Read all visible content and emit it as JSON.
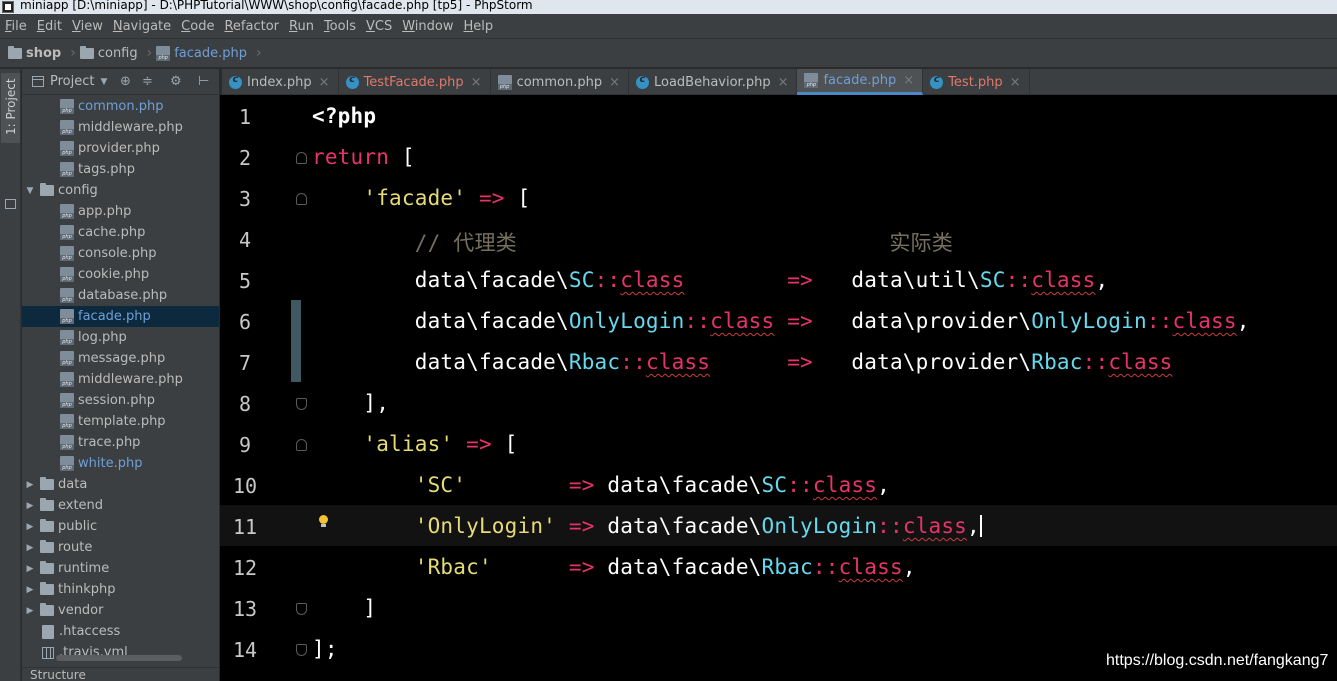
{
  "window": {
    "title": "miniapp [D:\\miniapp] - D:\\PHPTutorial\\WWW\\shop\\config\\facade.php [tp5] - PhpStorm"
  },
  "menu": [
    "File",
    "Edit",
    "View",
    "Navigate",
    "Code",
    "Refactor",
    "Run",
    "Tools",
    "VCS",
    "Window",
    "Help"
  ],
  "breadcrumb": [
    "shop",
    "config",
    "facade.php"
  ],
  "sidebar": {
    "stripe_label": "1: Project",
    "panel_title": "Project",
    "bottom_label": "Structure",
    "tree": [
      {
        "label": "common.php",
        "kind": "php",
        "indent": 2,
        "color": "blue"
      },
      {
        "label": "middleware.php",
        "kind": "php",
        "indent": 2
      },
      {
        "label": "provider.php",
        "kind": "php",
        "indent": 2
      },
      {
        "label": "tags.php",
        "kind": "php",
        "indent": 2
      },
      {
        "label": "config",
        "kind": "folder",
        "indent": 0,
        "open": true
      },
      {
        "label": "app.php",
        "kind": "php",
        "indent": 2
      },
      {
        "label": "cache.php",
        "kind": "php",
        "indent": 2
      },
      {
        "label": "console.php",
        "kind": "php",
        "indent": 2
      },
      {
        "label": "cookie.php",
        "kind": "php",
        "indent": 2
      },
      {
        "label": "database.php",
        "kind": "php",
        "indent": 2
      },
      {
        "label": "facade.php",
        "kind": "php",
        "indent": 2,
        "color": "blue",
        "selected": true
      },
      {
        "label": "log.php",
        "kind": "php",
        "indent": 2
      },
      {
        "label": "message.php",
        "kind": "php",
        "indent": 2
      },
      {
        "label": "middleware.php",
        "kind": "php",
        "indent": 2
      },
      {
        "label": "session.php",
        "kind": "php",
        "indent": 2
      },
      {
        "label": "template.php",
        "kind": "php",
        "indent": 2
      },
      {
        "label": "trace.php",
        "kind": "php",
        "indent": 2
      },
      {
        "label": "white.php",
        "kind": "php",
        "indent": 2,
        "color": "blue"
      },
      {
        "label": "data",
        "kind": "folder",
        "indent": 0
      },
      {
        "label": "extend",
        "kind": "folder",
        "indent": 0
      },
      {
        "label": "public",
        "kind": "folder",
        "indent": 0
      },
      {
        "label": "route",
        "kind": "folder",
        "indent": 0
      },
      {
        "label": "runtime",
        "kind": "folder",
        "indent": 0
      },
      {
        "label": "thinkphp",
        "kind": "folder",
        "indent": 0
      },
      {
        "label": "vendor",
        "kind": "folder",
        "indent": 0
      },
      {
        "label": ".htaccess",
        "kind": "file",
        "indent": 1
      },
      {
        "label": ".travis.yml",
        "kind": "grid",
        "indent": 1
      }
    ]
  },
  "tabs": [
    {
      "label": "Index.php",
      "icon": "class",
      "color": "normal"
    },
    {
      "label": "TestFacade.php",
      "icon": "class",
      "color": "red"
    },
    {
      "label": "common.php",
      "icon": "php",
      "color": "normal"
    },
    {
      "label": "LoadBehavior.php",
      "icon": "class",
      "color": "normal"
    },
    {
      "label": "facade.php",
      "icon": "php",
      "color": "blue",
      "active": true
    },
    {
      "label": "Test.php",
      "icon": "class",
      "color": "red"
    }
  ],
  "editor": {
    "current_line": 11,
    "lines": [
      {
        "n": "1",
        "tokens": [
          [
            "<?php",
            "b"
          ]
        ]
      },
      {
        "n": "2",
        "tokens": [
          [
            "return",
            "kw"
          ],
          [
            " [",
            ""
          ]
        ]
      },
      {
        "n": "3",
        "tokens": [
          [
            "    ",
            ""
          ],
          [
            "'facade'",
            "str"
          ],
          [
            " ",
            ""
          ],
          [
            "=>",
            "op"
          ],
          [
            " [",
            ""
          ]
        ]
      },
      {
        "n": "4",
        "tokens": [
          [
            "        ",
            ""
          ],
          [
            "// 代理类                             实际类",
            "cmt"
          ]
        ]
      },
      {
        "n": "5",
        "tokens": [
          [
            "        data\\facade\\",
            ""
          ],
          [
            "SC",
            "cls"
          ],
          [
            "::",
            "op"
          ],
          [
            "class",
            "kwu"
          ],
          [
            "        ",
            ""
          ],
          [
            "=>",
            "op"
          ],
          [
            "   data\\util\\",
            ""
          ],
          [
            "SC",
            "cls"
          ],
          [
            "::",
            "op"
          ],
          [
            "class",
            "kwu"
          ],
          [
            ",",
            ""
          ]
        ]
      },
      {
        "n": "6",
        "tokens": [
          [
            "        data\\facade\\",
            ""
          ],
          [
            "OnlyLogin",
            "cls"
          ],
          [
            "::",
            "op"
          ],
          [
            "class",
            "kwu"
          ],
          [
            " ",
            ""
          ],
          [
            "=>",
            "op"
          ],
          [
            "   data\\provider\\",
            ""
          ],
          [
            "OnlyLogin",
            "cls"
          ],
          [
            "::",
            "op"
          ],
          [
            "class",
            "kwu"
          ],
          [
            ",",
            ""
          ]
        ]
      },
      {
        "n": "7",
        "tokens": [
          [
            "        data\\facade\\",
            ""
          ],
          [
            "Rbac",
            "cls"
          ],
          [
            "::",
            "op"
          ],
          [
            "class",
            "kwu"
          ],
          [
            "      ",
            ""
          ],
          [
            "=>",
            "op"
          ],
          [
            "   data\\provider\\",
            ""
          ],
          [
            "Rbac",
            "cls"
          ],
          [
            "::",
            "op"
          ],
          [
            "class",
            "kwu"
          ]
        ]
      },
      {
        "n": "8",
        "tokens": [
          [
            "    ],",
            ""
          ]
        ]
      },
      {
        "n": "9",
        "tokens": [
          [
            "    ",
            ""
          ],
          [
            "'alias'",
            "str"
          ],
          [
            " ",
            ""
          ],
          [
            "=>",
            "op"
          ],
          [
            " [",
            ""
          ]
        ]
      },
      {
        "n": "10",
        "tokens": [
          [
            "        ",
            ""
          ],
          [
            "'SC'",
            "str"
          ],
          [
            "        ",
            ""
          ],
          [
            "=>",
            "op"
          ],
          [
            " data\\facade\\",
            ""
          ],
          [
            "SC",
            "cls"
          ],
          [
            "::",
            "op"
          ],
          [
            "class",
            "kwu"
          ],
          [
            ",",
            ""
          ]
        ]
      },
      {
        "n": "11",
        "tokens": [
          [
            "        ",
            ""
          ],
          [
            "'OnlyLogin'",
            "str"
          ],
          [
            " ",
            ""
          ],
          [
            "=>",
            "op"
          ],
          [
            " data\\facade\\",
            ""
          ],
          [
            "OnlyLogin",
            "cls"
          ],
          [
            "::",
            "op"
          ],
          [
            "class",
            "kwu"
          ],
          [
            ",",
            ""
          ]
        ]
      },
      {
        "n": "12",
        "tokens": [
          [
            "        ",
            ""
          ],
          [
            "'Rbac'",
            "str"
          ],
          [
            "      ",
            ""
          ],
          [
            "=>",
            "op"
          ],
          [
            " data\\facade\\",
            ""
          ],
          [
            "Rbac",
            "cls"
          ],
          [
            "::",
            "op"
          ],
          [
            "class",
            "kwu"
          ],
          [
            ",",
            ""
          ]
        ]
      },
      {
        "n": "13",
        "tokens": [
          [
            "    ]",
            ""
          ]
        ]
      },
      {
        "n": "14",
        "tokens": [
          [
            "];",
            ""
          ]
        ]
      }
    ]
  },
  "watermark": "https://blog.csdn.net/fangkang7",
  "colors": {
    "keyword": "#e8336a",
    "string": "#e6db74",
    "class": "#66d9ef",
    "comment": "#75715e",
    "selection": "#0d293e",
    "accent": "#4a88c7"
  }
}
